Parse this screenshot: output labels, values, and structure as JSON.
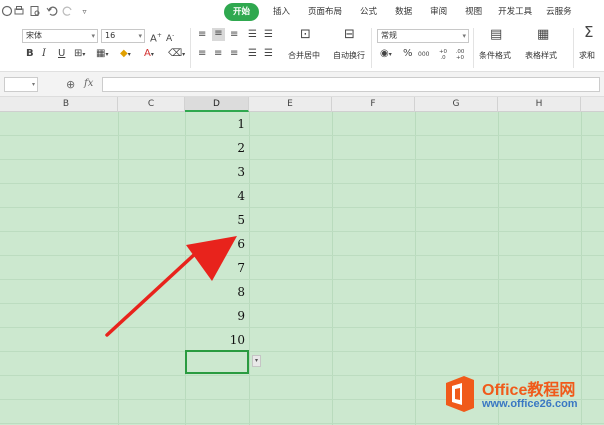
{
  "menu": {
    "tabs": [
      "开始",
      "插入",
      "页面布局",
      "公式",
      "数据",
      "审阅",
      "视图",
      "开发工具",
      "云服务"
    ],
    "active": "开始"
  },
  "ribbon": {
    "font_name": "宋体",
    "font_size": "16",
    "bold": "B",
    "italic": "I",
    "underline": "U",
    "merge_center": "合并居中",
    "auto_wrap": "自动换行",
    "number_format": "常规",
    "percent": "%",
    "thousands": "000",
    "dec_inc": "+0 .0",
    "dec_dec": ".00 +0",
    "conditional_format": "条件格式",
    "table_style": "表格样式",
    "sum": "求和"
  },
  "formula_bar": {
    "fx": "fx",
    "value": ""
  },
  "columns": [
    "B",
    "C",
    "D",
    "E",
    "F",
    "G",
    "H"
  ],
  "selected_column": "D",
  "cells": [
    "1",
    "2",
    "3",
    "4",
    "5",
    "6",
    "7",
    "8",
    "9",
    "10"
  ],
  "watermark": {
    "title": "Office教程网",
    "url": "www.office26.com"
  },
  "colors": {
    "accent": "#2fa84f",
    "grid_fill": "#cce8cf",
    "arrow": "#e8231c",
    "watermark_orange": "#f05a1a",
    "watermark_blue": "#3a78c3"
  }
}
